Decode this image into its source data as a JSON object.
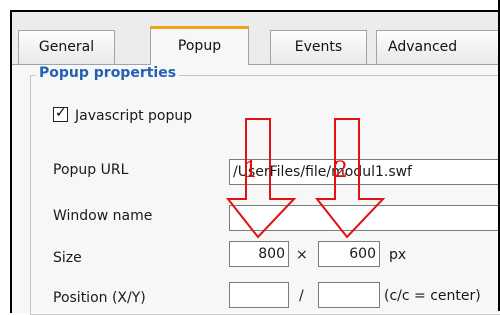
{
  "tabs": [
    {
      "label": "General",
      "active": false
    },
    {
      "label": "Popup",
      "active": true
    },
    {
      "label": "Events",
      "active": false
    },
    {
      "label": "Advanced",
      "active": false
    }
  ],
  "section": {
    "legend": "Popup properties"
  },
  "javascript_popup": {
    "label": "Javascript popup",
    "checked": true
  },
  "popup_url": {
    "label": "Popup URL",
    "value": "/UserFiles/file/modul1.swf"
  },
  "window_name": {
    "label": "Window name",
    "value": ""
  },
  "size": {
    "label": "Size",
    "width": "800",
    "separator": "×",
    "height": "600",
    "unit": "px"
  },
  "position": {
    "label": "Position (X/Y)",
    "x": "",
    "separator": "/",
    "y": "",
    "hint": "(c/c = center)"
  },
  "annotations": {
    "arrow1": "1",
    "arrow2": "2",
    "color": "#e11111"
  },
  "colors": {
    "legend": "#2460b3",
    "active_tab_accent": "#f0a21a"
  }
}
